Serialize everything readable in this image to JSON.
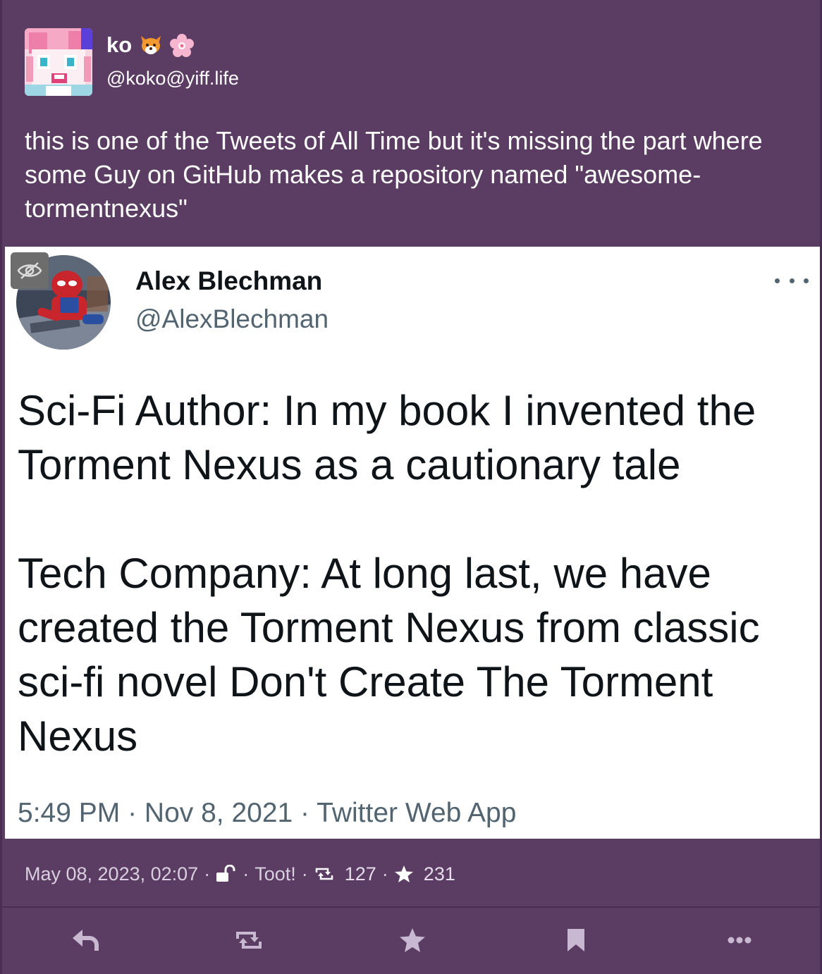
{
  "account": {
    "display_name": "ko",
    "name_emojis": [
      "fox-emoji",
      "cherry-blossom-emoji"
    ],
    "acct": "@koko@yiff.life"
  },
  "status": {
    "content": "this is one of the Tweets of All Time but it's missing the part where some Guy on GitHub makes a repository named \"awesome-tormentnexus\"",
    "timestamp": "May 08, 2023, 02:07",
    "visibility_icon": "unlock-icon",
    "application": "Toot!",
    "reblog_count": "127",
    "favourite_count": "231",
    "separator": "·"
  },
  "embedded_tweet": {
    "author_name": "Alex Blechman",
    "author_handle": "@AlexBlechman",
    "paragraph_1": "Sci-Fi Author: In my book I invented the Torment Nexus as a cautionary tale",
    "paragraph_2": "Tech Company: At long last, we have created the Torment Nexus from classic sci-fi novel Don't Create The Torment Nexus",
    "meta": "5:49 PM · Nov 8, 2021 · Twitter Web App"
  },
  "actions": [
    "reply-icon",
    "boost-icon",
    "favourite-icon",
    "bookmark-icon",
    "more-icon"
  ],
  "colors": {
    "background": "#5b3c62",
    "card": "#ffffff",
    "tweet_text": "#0f1419",
    "tweet_muted": "#536471",
    "meta_text": "#d9cfe0",
    "action_icon": "#c9b8d2"
  }
}
